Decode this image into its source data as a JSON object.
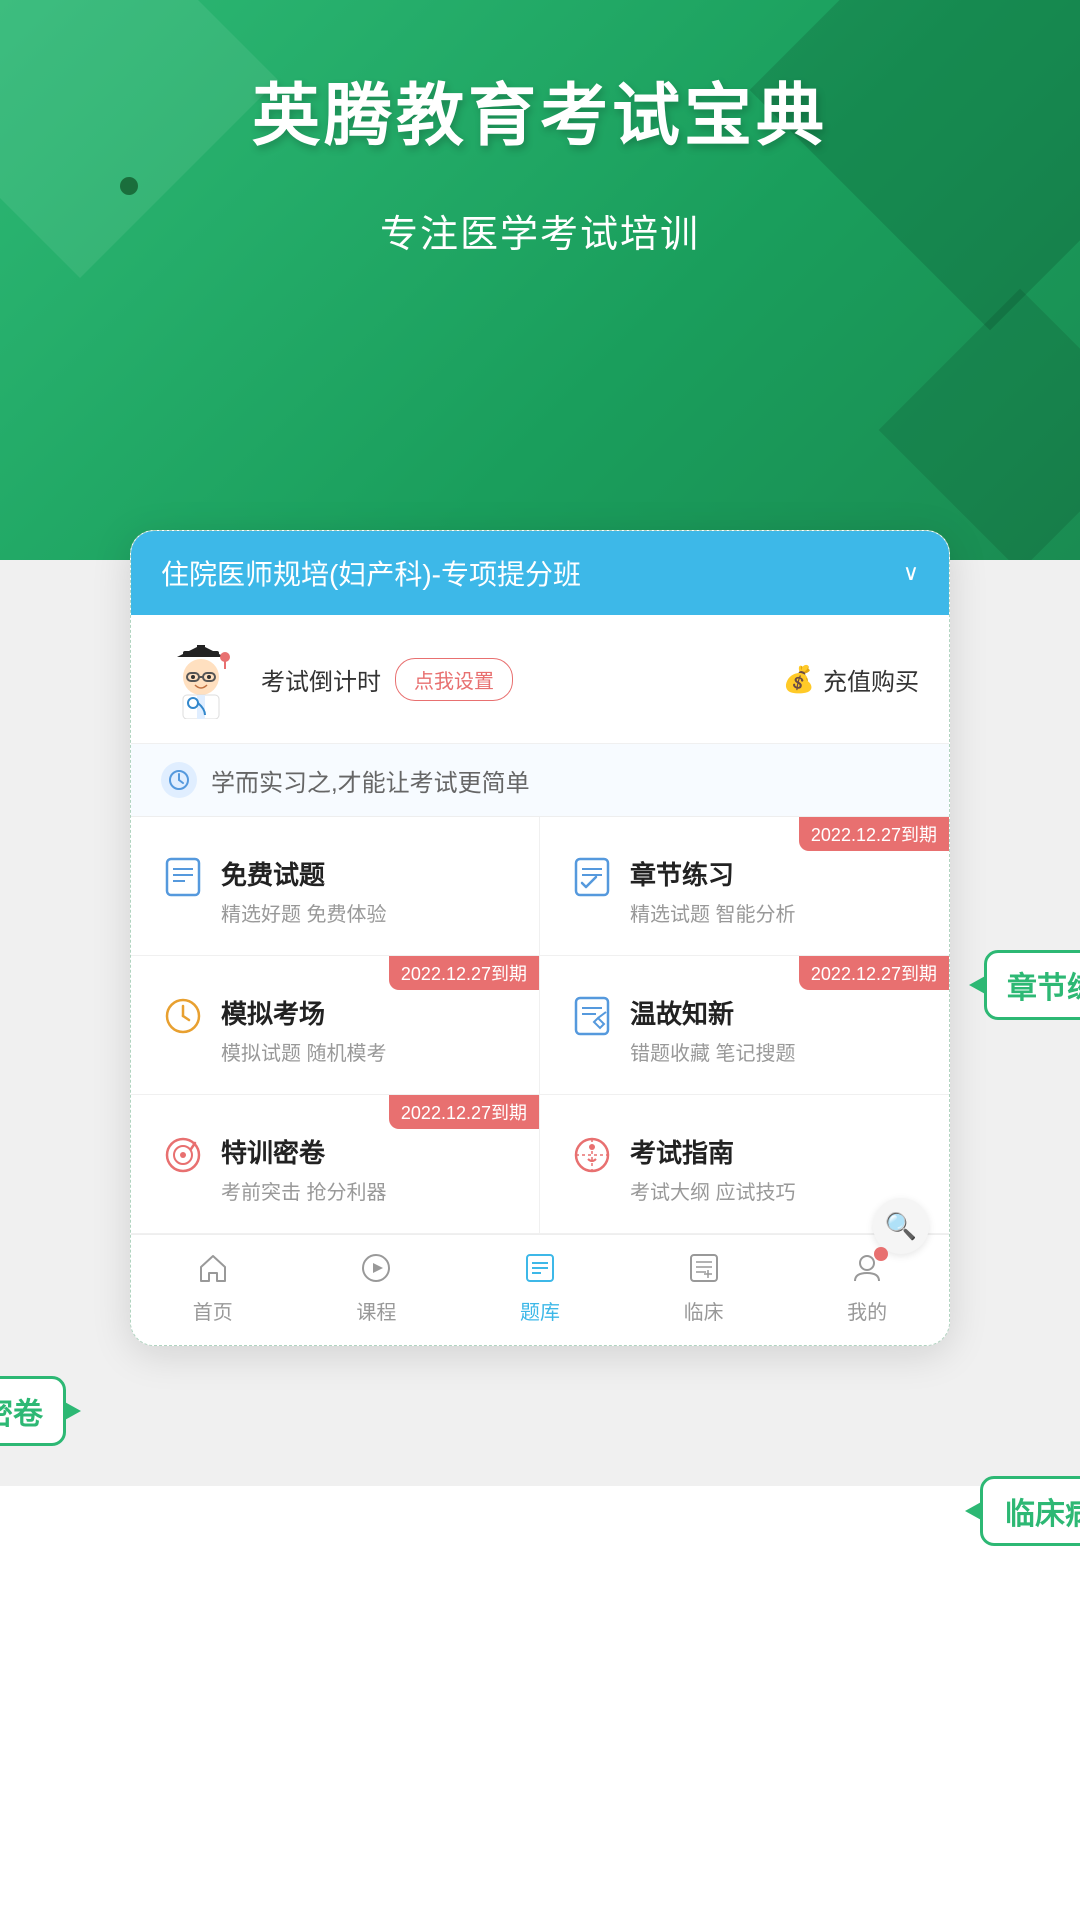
{
  "hero": {
    "title": "英腾教育考试宝典",
    "subtitle": "专注医学考试培训"
  },
  "appHeader": {
    "title": "住院医师规培(妇产科)-专项提分班",
    "arrow": "∨"
  },
  "userInfo": {
    "countdown_label": "考试倒计时",
    "set_button": "点我设置",
    "recharge_label": "充值购买"
  },
  "motto": {
    "text": "学而实习之,才能让考试更简单"
  },
  "features": [
    {
      "id": "free-questions",
      "title": "免费试题",
      "desc": "精选好题 免费体验",
      "badge": null,
      "icon_color": "#5599dd",
      "icon_type": "document"
    },
    {
      "id": "chapter-practice",
      "title": "章节练习",
      "desc": "精选试题 智能分析",
      "badge": "2022.12.27到期",
      "icon_color": "#5599dd",
      "icon_type": "document-check"
    },
    {
      "id": "mock-exam",
      "title": "模拟考场",
      "desc": "模拟试题 随机模考",
      "badge": "2022.12.27到期",
      "icon_color": "#e8a030",
      "icon_type": "clock"
    },
    {
      "id": "review",
      "title": "温故知新",
      "desc": "错题收藏 笔记搜题",
      "badge": "2022.12.27到期",
      "icon_color": "#5599dd",
      "icon_type": "document-edit"
    },
    {
      "id": "special-exam",
      "title": "特训密卷",
      "desc": "考前突击 抢分利器",
      "badge": "2022.12.27到期",
      "icon_color": "#e87070",
      "icon_type": "target"
    },
    {
      "id": "exam-guide",
      "title": "考试指南",
      "desc": "考试大纲 应试技巧",
      "badge": null,
      "icon_color": "#e87070",
      "icon_type": "compass"
    }
  ],
  "bottomNav": [
    {
      "id": "home",
      "label": "首页",
      "active": false,
      "has_dot": false
    },
    {
      "id": "course",
      "label": "课程",
      "active": false,
      "has_dot": false
    },
    {
      "id": "question-bank",
      "label": "题库",
      "active": true,
      "has_dot": false
    },
    {
      "id": "clinical",
      "label": "临床",
      "active": false,
      "has_dot": false
    },
    {
      "id": "mine",
      "label": "我的",
      "active": false,
      "has_dot": true
    }
  ],
  "callouts": {
    "chapter_practice": "章节练习",
    "special_exam": "特训密卷",
    "clinical_case": "临床病例"
  }
}
